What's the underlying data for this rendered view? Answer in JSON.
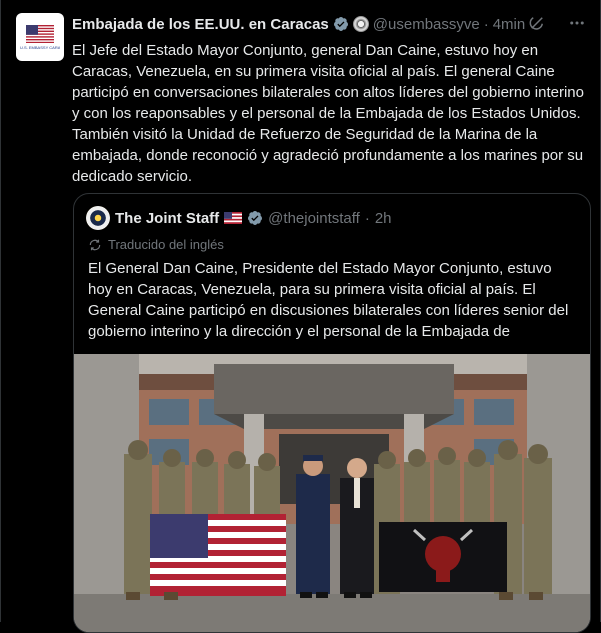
{
  "tweet": {
    "author_name": "Embajada de los EE.UU. en Caracas",
    "handle": "@usembassyve",
    "separator": "·",
    "time": "4min",
    "avatar_caption": "U.S. EMBASSY CARACAS",
    "text": "El Jefe del Estado Mayor Conjunto, general Dan Caine, estuvo hoy en Caracas, Venezuela, en su primera visita oficial al país. El general Caine participó en conversaciones bilaterales con altos líderes del gobierno interino y con los reaponsables y el personal de la Embajada de los Estados Unidos. También visitó la Unidad de Refuerzo de Seguridad de la Marina de la embajada, donde reconoció y agradeció profundamente a los marines por su dedicado servicio."
  },
  "quote": {
    "author_name": "The Joint Staff",
    "handle": "@thejointstaff",
    "separator": "·",
    "time": "2h",
    "translated_label": "Traducido del inglés",
    "text": "El General Dan Caine, Presidente del Estado Mayor Conjunto, estuvo hoy en Caracas, Venezuela, para su primera visita oficial al país. El General Caine participó en discusiones bilaterales con líderes senior del gobierno interino y la dirección y el personal de la Embajada de"
  },
  "icons": {
    "verified": "verified-badge-icon",
    "grok": "grok-icon",
    "more": "more-options-icon",
    "translate": "translate-icon"
  },
  "colors": {
    "background": "#000000",
    "text": "#e7e9ea",
    "muted": "#71767b",
    "border": "#2f3336",
    "verified": "#829aab"
  }
}
